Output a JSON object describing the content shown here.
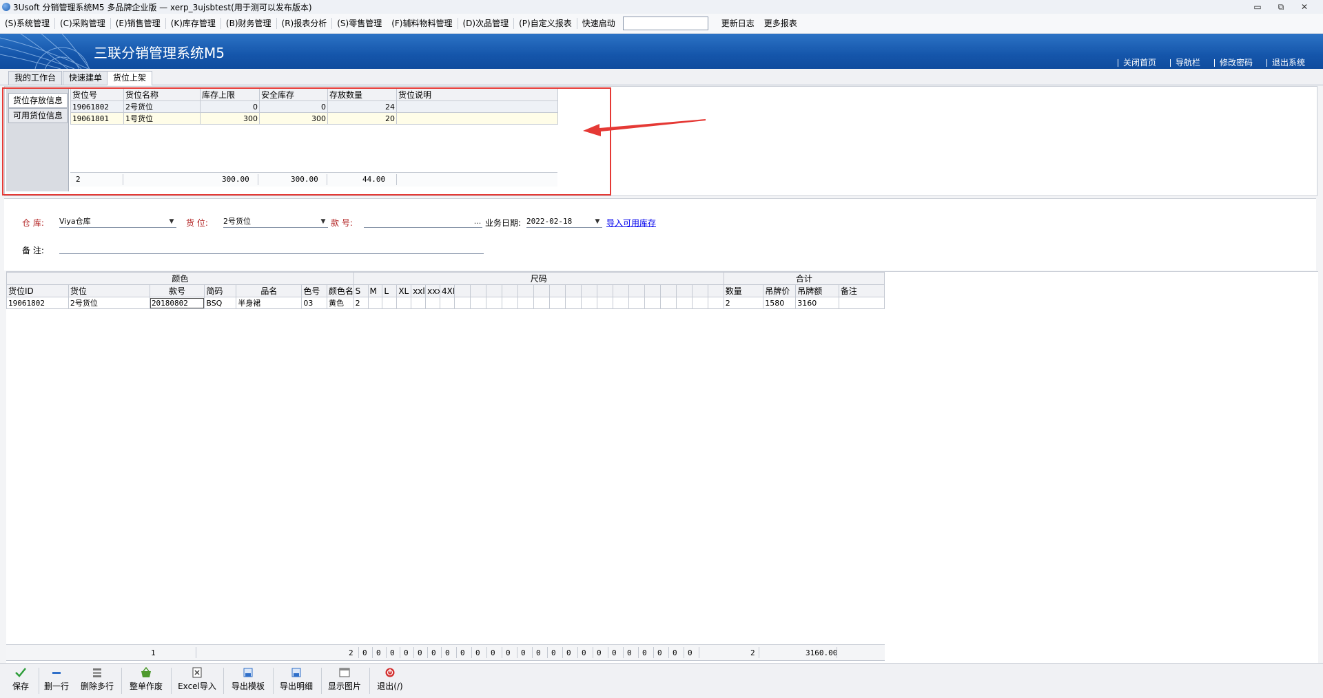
{
  "window": {
    "title": "3Usoft 分销管理系统M5 多品牌企业版 — xerp_3ujsbtest(用于测可以发布版本)",
    "minimize": "▭",
    "restore": "⧉",
    "close": "✕"
  },
  "menu": {
    "items": [
      "(S)系统管理",
      "(C)采购管理",
      "(E)销售管理",
      "(K)库存管理",
      "(B)财务管理",
      "(R)报表分析",
      "(S)零售管理",
      "(F)辅料物料管理",
      "(D)次品管理",
      "(P)自定义报表"
    ],
    "quick_launch_label": "快速启动",
    "quick_launch_value": "",
    "changelog": "更新日志",
    "more_reports": "更多报表"
  },
  "banner": {
    "title": "三联分销管理系统M5",
    "nav": [
      "关闭首页",
      "导航栏",
      "修改密码",
      "退出系统"
    ],
    "color": "#1556ab"
  },
  "tabs": [
    "我的工作台",
    "快速建单",
    "货位上架"
  ],
  "active_tab": "货位上架",
  "location_panel": {
    "side_tabs": [
      "货位存放信息",
      "可用货位信息"
    ],
    "columns": [
      "货位号",
      "货位名称",
      "库存上限",
      "安全库存",
      "存放数量",
      "货位说明"
    ],
    "rows": [
      [
        "19061802",
        "2号货位",
        "0",
        "0",
        "24",
        ""
      ],
      [
        "19061801",
        "1号货位",
        "300",
        "300",
        "20",
        ""
      ]
    ],
    "footer": [
      "2",
      "300.00",
      "300.00",
      "44.00"
    ],
    "highlight_color": "#e53935"
  },
  "form": {
    "warehouse_label": "仓  库:",
    "warehouse_value": "Viya仓库",
    "location_label": "货  位:",
    "location_value": "2号货位",
    "style_label": "款 号:",
    "style_value": "",
    "style_button": "...",
    "date_label": "业务日期:",
    "date_value": "2022-02-18",
    "import_link": "导入可用库存",
    "remark_label": "备  注:",
    "remark_value": ""
  },
  "main_grid": {
    "group_headers": [
      "颜色",
      "尺码",
      "合计"
    ],
    "columns": [
      "货位ID",
      "货位",
      "款号",
      "简码",
      "品名",
      "色号",
      "颜色名",
      "S",
      "M",
      "L",
      "XL",
      "xxl",
      "xxx",
      "4XL",
      "",
      "",
      "",
      "",
      "",
      "",
      "",
      "",
      "",
      "",
      "",
      "",
      "",
      "",
      "",
      "",
      "",
      "数量",
      "吊牌价",
      "吊牌额",
      "备注"
    ],
    "rows": [
      [
        "19061802",
        "2号货位",
        "20180802",
        "BSQ",
        "半身裙",
        "03",
        "黄色",
        "2",
        "",
        "",
        "",
        "",
        "",
        "",
        "",
        "",
        "",
        "",
        "",
        "",
        "",
        "",
        "",
        "",
        "",
        "",
        "",
        "",
        "",
        "",
        "",
        "2",
        "1580",
        "3160",
        ""
      ]
    ],
    "footer_count": "1",
    "footer_size_totals": [
      "2",
      "0",
      "0",
      "0",
      "0",
      "0",
      "0",
      "0",
      "0",
      "0",
      "0",
      "0",
      "0",
      "0",
      "0",
      "0",
      "0",
      "0",
      "0",
      "0",
      "0",
      "0",
      "0",
      "0"
    ],
    "footer_qty": "2",
    "footer_amount": "3160.00"
  },
  "toolbar": {
    "buttons": [
      {
        "label": "保存",
        "icon": "check-icon",
        "color": "#2e9d3a"
      },
      {
        "label": "删一行",
        "icon": "minus-icon",
        "color": "#2f6fc9"
      },
      {
        "label": "删除多行",
        "icon": "delete-rows-icon",
        "color": "#666666"
      },
      {
        "label": "整单作废",
        "icon": "basket-icon",
        "color": "#4f9a2e"
      },
      {
        "label": "Excel导入",
        "icon": "excel-import-icon",
        "color": "#444444"
      },
      {
        "label": "导出模板",
        "icon": "export-template-icon",
        "color": "#2f6fc9"
      },
      {
        "label": "导出明细",
        "icon": "export-detail-icon",
        "color": "#2f6fc9"
      },
      {
        "label": "显示图片",
        "icon": "picture-icon",
        "color": "#555555"
      },
      {
        "label": "退出(/)",
        "icon": "exit-icon",
        "color": "#d32f2f"
      }
    ]
  }
}
